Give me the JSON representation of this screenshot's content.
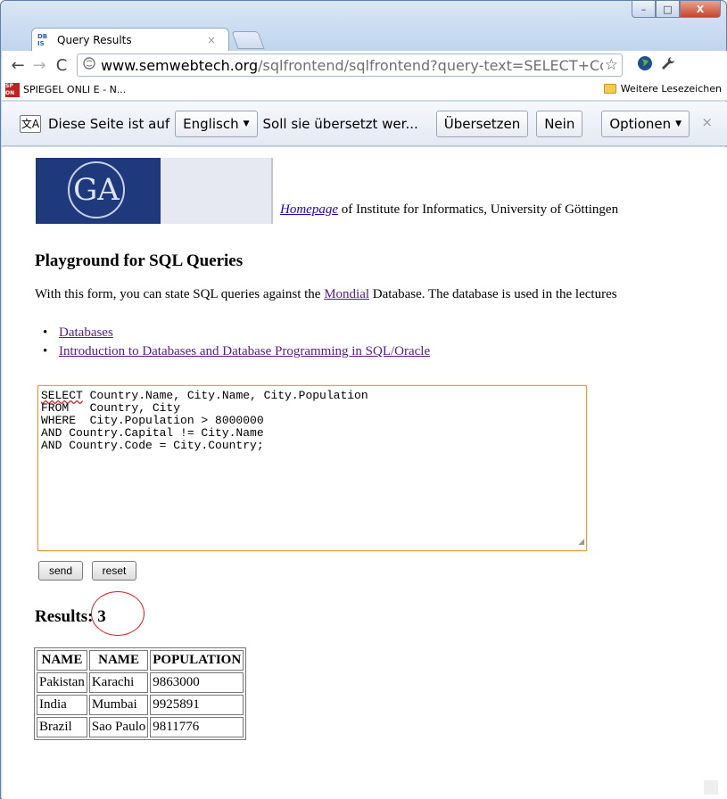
{
  "tab": {
    "title": "Query Results",
    "close": "×",
    "favicon_text": "DB IS"
  },
  "window": {
    "minimize": "–",
    "maximize": "□",
    "close": "X"
  },
  "toolbar": {
    "back": "←",
    "forward": "→",
    "reload": "C",
    "url_host": "www.semwebtech.org",
    "url_path": "/sqlfrontend/sqlfrontend?query-text=SELECT+Cou",
    "star": "☆",
    "page_icon": "●",
    "wrench": "🔧"
  },
  "bookmarks": {
    "item": "SPIEGEL ONLI",
    "item_suffix": "E - N...",
    "favicon_text": "SP ON",
    "other": "Weitere Lesezeichen"
  },
  "translate_bar": {
    "icon": "文A",
    "prefix": "Diese Seite ist auf",
    "language": "Englisch",
    "question": "Soll sie übersetzt wer...",
    "translate": "Übersetzen",
    "no": "Nein",
    "options": "Optionen",
    "close": "×"
  },
  "page": {
    "homepage_link": "Homepage",
    "header_caption": " of Institute for Informatics, University of Göttingen",
    "title": "Playground for SQL Queries",
    "intro_before": "With this form, you can state SQL queries against the ",
    "intro_link": "Mondial",
    "intro_after": " Database. The database is used in the lectures",
    "links": [
      "Databases",
      "Introduction to Databases and Database Programming in SQL/Oracle"
    ],
    "query_first_word": "SELECT",
    "query_first_rest": " Country.Name, City.Name, City.Population",
    "query_rest": "FROM   Country, City\nWHERE  City.Population > 8000000\nAND Country.Capital != City.Name\nAND Country.Code = City.Country;",
    "send": "send",
    "reset": "reset",
    "results_label": "Results: 3"
  },
  "results_table": {
    "headers": [
      "NAME",
      "NAME",
      "POPULATION"
    ],
    "rows": [
      [
        "Pakistan",
        "Karachi",
        "9863000"
      ],
      [
        "India",
        "Mumbai",
        "9925891"
      ],
      [
        "Brazil",
        "Sao Paulo",
        "9811776"
      ]
    ]
  },
  "colors": {
    "link": "#2200cc",
    "visited_link": "#551a8b",
    "logo_blue": "#1e3a7d",
    "annotation": "#e02020"
  }
}
